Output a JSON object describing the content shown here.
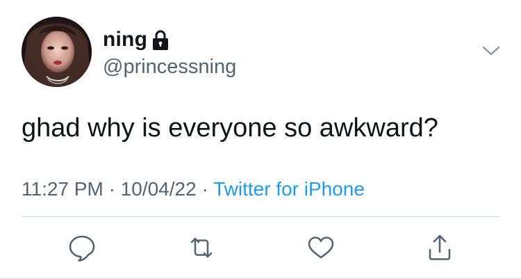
{
  "tweet": {
    "author": {
      "display_name": "ning",
      "handle": "@princessning",
      "protected_icon": "lock-icon",
      "avatar": "profile-photo"
    },
    "text": "ghad why is everyone so awkward?",
    "time": "11:27 PM",
    "date": "10/04/22",
    "separator": "·",
    "source": "Twitter for iPhone"
  },
  "actions": {
    "reply_icon": "speech-bubble-icon",
    "retweet_icon": "retweet-icon",
    "like_icon": "heart-icon",
    "share_icon": "share-icon"
  },
  "colors": {
    "text": "#0f1419",
    "secondary": "#536471",
    "link": "#1d9bf0",
    "divider": "#cfd9de"
  }
}
